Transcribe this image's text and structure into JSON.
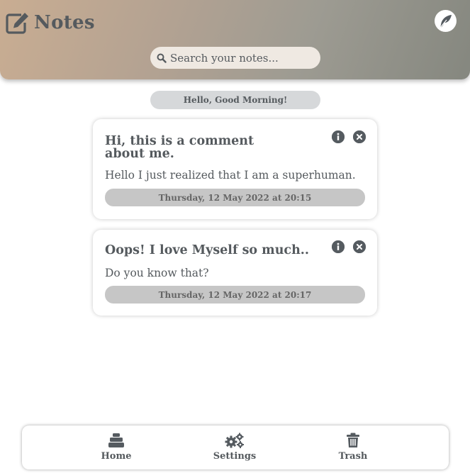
{
  "header": {
    "app_title": "Notes",
    "app_icon": "edit-icon",
    "feather_icon": "feather-icon",
    "search": {
      "placeholder": "Search your notes...",
      "value": "",
      "icon": "search-icon"
    }
  },
  "greeting": "Hello, Good Morning!",
  "notes": [
    {
      "title": "Hi, this is a comment about me.",
      "body": "Hello I just realized that I am a superhuman.",
      "date": "Thursday, 12 May 2022 at 20:15"
    },
    {
      "title": "Oops! I love Myself so much..",
      "body": "Do you know that?",
      "date": "Thursday, 12 May 2022 at 20:17"
    }
  ],
  "nav": {
    "home": {
      "label": "Home",
      "icon": "home-icon"
    },
    "settings": {
      "label": "Settings",
      "icon": "gears-icon"
    },
    "trash": {
      "label": "Trash",
      "icon": "trash-icon"
    }
  },
  "colors": {
    "header_gradient_start": "#c9ad92",
    "header_gradient_end": "#85877f",
    "text": "#555a5e",
    "date_pill": "#c6c6c6",
    "greeting_pill": "#d6d8da",
    "icon": "#555b60"
  }
}
